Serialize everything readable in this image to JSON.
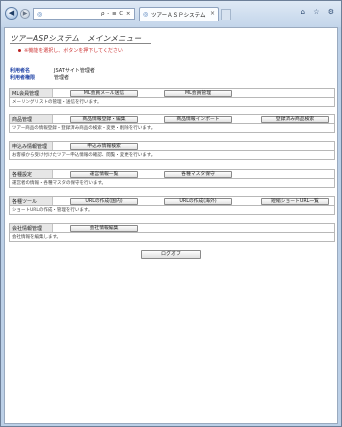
{
  "browser": {
    "address_tools": "ρ - ≡ C ×",
    "tab_title": "ツアーＡＳＰシステム",
    "tab_close": "×",
    "window_icons": "⌂ ☆ ⚙"
  },
  "page": {
    "title": "ツアーASPシステム　メインメニュー",
    "notice": "※機能を選択し、ボタンを押下してください",
    "info": [
      {
        "label": "利用者名",
        "value": "JSATサイト管理者"
      },
      {
        "label": "利用者権限",
        "value": "管理者"
      }
    ],
    "sections": [
      {
        "label": "ML会員管理",
        "buttons": [
          "ML会員メール送信",
          "ML会員管理"
        ],
        "desc": "メーリングリストの管理・送信を行います。"
      },
      {
        "label": "商品管理",
        "buttons": [
          "商品情報登録・編集",
          "商品情報インポート",
          "登録済み商品検索"
        ],
        "desc": "ツアー商品の情報登録・登録済み商品の検索・変更・削除を行います。"
      },
      {
        "label": "申込み情報管理",
        "buttons": [
          "申込み情報検索"
        ],
        "desc": "お客様から受け付けたツアー申込情報の確認、閲覧・変更を行います。"
      },
      {
        "label": "各種設定",
        "buttons": [
          "運営情報一覧",
          "各種マスタ保守"
        ],
        "desc": "運営者の情報・各種マスタの保守を行います。"
      },
      {
        "label": "各種ツール",
        "buttons": [
          "URLの作成(国内)",
          "URLの作成(海外)",
          "短縮ショートURL一覧"
        ],
        "desc": "ショートURLの作成・管理を行います。"
      },
      {
        "label": "会社情報管理",
        "buttons": [
          "会社情報編集"
        ],
        "desc": "会社情報を編集します。"
      }
    ],
    "logout_label": "ログオフ"
  }
}
